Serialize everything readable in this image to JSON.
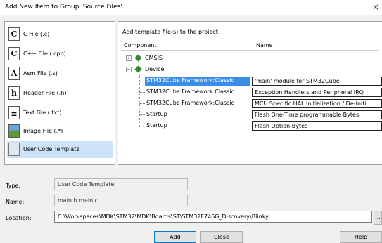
{
  "window": {
    "title": "Add New Item to Group 'Source Files'",
    "close_glyph": "×"
  },
  "file_types": [
    {
      "label": "C File (.c)",
      "icon": "c-file-icon",
      "glyph": "C"
    },
    {
      "label": "C++ File (.cpp)",
      "icon": "cpp-file-icon",
      "glyph": "C"
    },
    {
      "label": "Asm File (.s)",
      "icon": "asm-file-icon",
      "glyph": "A"
    },
    {
      "label": "Header File (.h)",
      "icon": "header-file-icon",
      "glyph": "h"
    },
    {
      "label": "Text File (.txt)",
      "icon": "text-file-icon",
      "glyph": "≡"
    },
    {
      "label": "Image File (.*)",
      "icon": "image-file-icon",
      "glyph": ""
    },
    {
      "label": "User Code Template",
      "icon": "user-code-template-icon",
      "glyph": "",
      "selected": true
    }
  ],
  "templates": {
    "hint": "Add template file(s) to the project.",
    "col_component": "Component",
    "col_name": "Name",
    "groups": [
      {
        "label": "CMSIS",
        "expander": "+"
      },
      {
        "label": "Device",
        "expander": "−"
      }
    ],
    "rows": [
      {
        "component": "STM32Cube Framework:Classic",
        "name": "'main' module for STM32Cube",
        "selected": true
      },
      {
        "component": "STM32Cube Framework:Classic",
        "name": "Exception Handlers and Peripheral IRQ"
      },
      {
        "component": "STM32Cube Framework:Classic",
        "name": "MCU Specific HAL Initialization / De-Initi..."
      },
      {
        "component": "Startup",
        "name": "Flash One-Time programmable Bytes"
      },
      {
        "component": "Startup",
        "name": "Flash Option Bytes"
      }
    ]
  },
  "fields": {
    "type_label": "Type:",
    "type_value": "User Code Template",
    "name_label": "Name:",
    "name_value": "main.h main.c",
    "location_label": "Location:",
    "location_value": "C:\\Workspaces\\MDK\\STM32\\MDK\\Boards\\ST\\STM32F746G_Discovery\\Blinky",
    "browse_label": "..."
  },
  "buttons": {
    "add": "Add",
    "close": "Close",
    "help": "Help"
  }
}
